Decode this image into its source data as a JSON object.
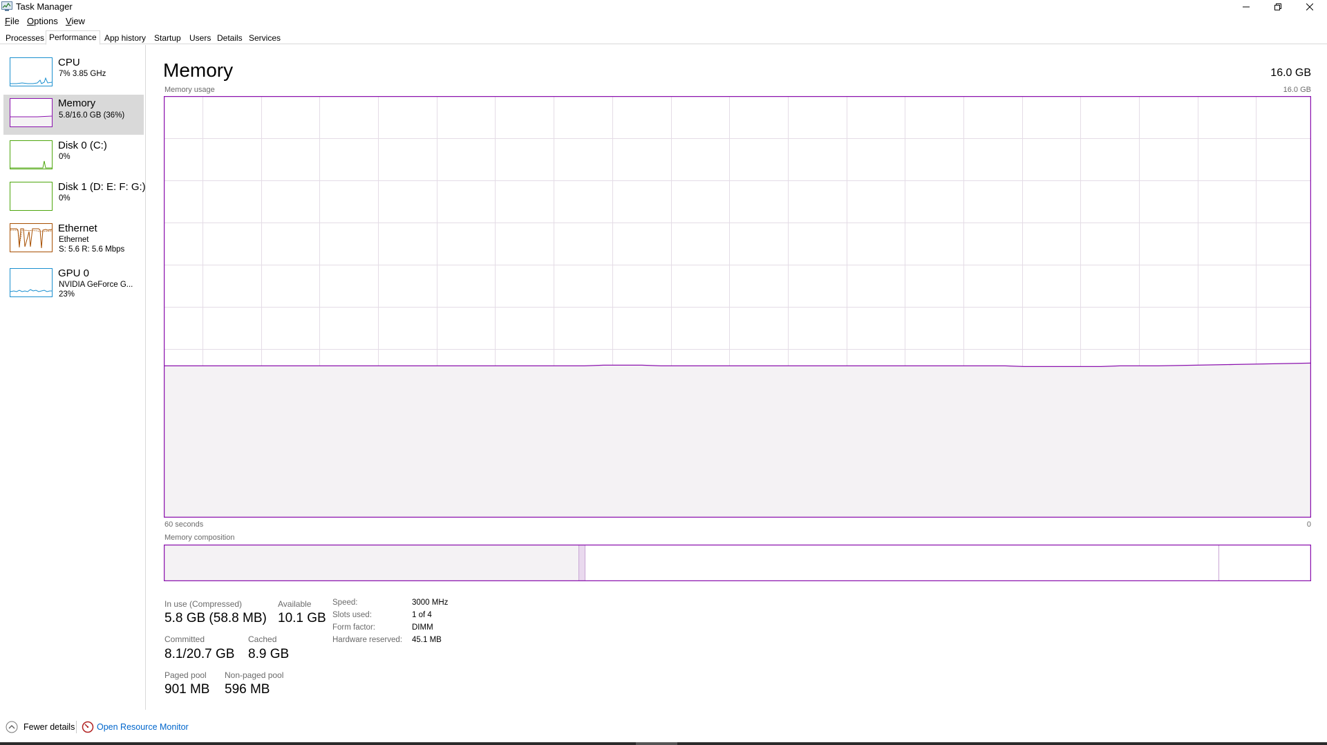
{
  "window": {
    "title": "Task Manager"
  },
  "menu": {
    "file": {
      "first": "F",
      "rest": "ile"
    },
    "options": {
      "first": "O",
      "rest": "ptions"
    },
    "view": {
      "first": "V",
      "rest": "iew"
    }
  },
  "tabs": [
    {
      "label": "Processes",
      "active": false
    },
    {
      "label": "Performance",
      "active": true
    },
    {
      "label": "App history",
      "active": false
    },
    {
      "label": "Startup",
      "active": false
    },
    {
      "label": "Users",
      "active": false
    },
    {
      "label": "Details",
      "active": false
    },
    {
      "label": "Services",
      "active": false
    }
  ],
  "sidebar": {
    "items": [
      {
        "title": "CPU",
        "line1": "7% 3.85 GHz",
        "line2": "",
        "color": "#1a8fcf",
        "active": false
      },
      {
        "title": "Memory",
        "line1": "5.8/16.0 GB (36%)",
        "line2": "",
        "color": "#8b12ae",
        "active": true
      },
      {
        "title": "Disk 0 (C:)",
        "line1": "0%",
        "line2": "",
        "color": "#4da60c",
        "active": false
      },
      {
        "title": "Disk 1 (D: E: F: G:)",
        "line1": "0%",
        "line2": "",
        "color": "#4da60c",
        "active": false
      },
      {
        "title": "Ethernet",
        "line1": "Ethernet",
        "line2": "S: 5.6 R: 5.6 Mbps",
        "color": "#a74f01",
        "active": false
      },
      {
        "title": "GPU 0",
        "line1": "NVIDIA GeForce G...",
        "line2": "23%",
        "color": "#1a8fcf",
        "active": false
      }
    ]
  },
  "main": {
    "title": "Memory",
    "total": "16.0 GB",
    "usage_label": "Memory usage",
    "usage_max": "16.0 GB",
    "time_left": "60 seconds",
    "time_right": "0",
    "composition_label": "Memory composition",
    "usage_fraction": 0.36,
    "accent": "#8b12ae",
    "fill": "#f4f2f4"
  },
  "stats": {
    "in_use_label": "In use (Compressed)",
    "in_use_value": "5.8 GB (58.8 MB)",
    "available_label": "Available",
    "available_value": "10.1 GB",
    "committed_label": "Committed",
    "committed_value": "8.1/20.7 GB",
    "cached_label": "Cached",
    "cached_value": "8.9 GB",
    "paged_label": "Paged pool",
    "paged_value": "901 MB",
    "nonpaged_label": "Non-paged pool",
    "nonpaged_value": "596 MB"
  },
  "specs": {
    "speed_label": "Speed:",
    "speed_value": "3000 MHz",
    "slots_label": "Slots used:",
    "slots_value": "1 of 4",
    "form_label": "Form factor:",
    "form_value": "DIMM",
    "reserved_label": "Hardware reserved:",
    "reserved_value": "45.1 MB"
  },
  "footer": {
    "fewer_details": "Fewer details",
    "open_monitor": "Open Resource Monitor"
  }
}
